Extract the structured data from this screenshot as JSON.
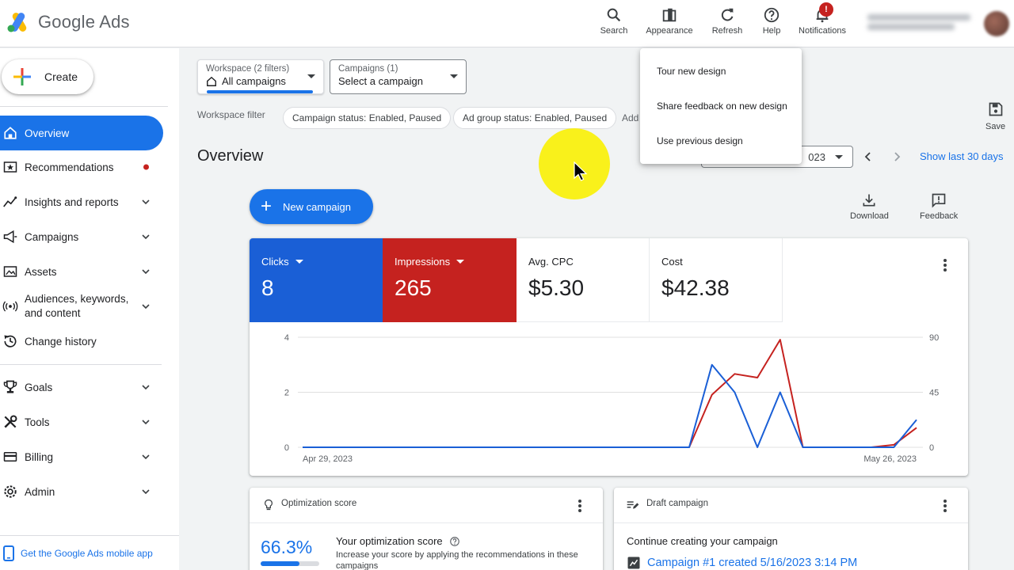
{
  "app": {
    "logo_text": "Google Ads"
  },
  "topbar": {
    "search": "Search",
    "appearance": "Appearance",
    "refresh": "Refresh",
    "help": "Help",
    "notifications": "Notifications",
    "notification_badge": "!"
  },
  "sidebar": {
    "create": "Create",
    "items": [
      {
        "label": "Overview"
      },
      {
        "label": "Recommendations"
      },
      {
        "label": "Insights and reports"
      },
      {
        "label": "Campaigns"
      },
      {
        "label": "Assets"
      },
      {
        "label": "Audiences, keywords,",
        "label2": "and content"
      },
      {
        "label": "Change history"
      },
      {
        "label": "Goals"
      },
      {
        "label": "Tools"
      },
      {
        "label": "Billing"
      },
      {
        "label": "Admin"
      }
    ],
    "mobile_app": "Get the Google Ads mobile app"
  },
  "filters": {
    "workspace_small": "Workspace (2 filters)",
    "workspace_value": "All campaigns",
    "campaigns_small": "Campaigns (1)",
    "campaigns_value": "Select a campaign",
    "workspace_filter_label": "Workspace filter",
    "chips": [
      "Campaign status: Enabled, Paused",
      "Ad group status: Enabled, Paused",
      "Add"
    ]
  },
  "page": {
    "title": "Overview",
    "save": "Save",
    "date_value": "023",
    "show_last": "Show last 30 days",
    "new_campaign": "New campaign",
    "download": "Download",
    "feedback": "Feedback"
  },
  "appearance_menu": {
    "items": [
      "Tour new design",
      "Share feedback on new design",
      "Use previous design"
    ]
  },
  "metrics": [
    {
      "label": "Clicks",
      "value": "8",
      "color": "#1a5fd6",
      "selected": true
    },
    {
      "label": "Impressions",
      "value": "265",
      "color": "#c5221f",
      "selected": true
    },
    {
      "label": "Avg. CPC",
      "value": "$5.30",
      "selected": false
    },
    {
      "label": "Cost",
      "value": "$42.38",
      "selected": false
    }
  ],
  "chart_data": {
    "type": "line",
    "x_start_label": "Apr 29, 2023",
    "x_end_label": "May 26, 2023",
    "left_axis_ticks": [
      "0",
      "2",
      "4"
    ],
    "right_axis_ticks": [
      "0",
      "45",
      "90"
    ],
    "ylim_left": [
      0,
      4
    ],
    "ylim_right": [
      0,
      90
    ],
    "x_count": 28,
    "series": [
      {
        "name": "Clicks",
        "axis": "left",
        "color": "#1a5fd6",
        "values": [
          0,
          0,
          0,
          0,
          0,
          0,
          0,
          0,
          0,
          0,
          0,
          0,
          0,
          0,
          0,
          0,
          0,
          0,
          3,
          2,
          0,
          2,
          0,
          0,
          0,
          0,
          0,
          1
        ]
      },
      {
        "name": "Impressions",
        "axis": "right",
        "color": "#c5221f",
        "values": [
          0,
          0,
          0,
          0,
          0,
          0,
          0,
          0,
          0,
          0,
          0,
          0,
          0,
          0,
          0,
          0,
          0,
          0,
          43,
          60,
          57,
          88,
          0,
          0,
          0,
          0,
          2,
          16
        ]
      }
    ]
  },
  "optimization_card": {
    "title": "Optimization score",
    "score": "66.3%",
    "score_fraction": 0.663,
    "heading": "Your optimization score",
    "description": "Increase your score by applying the recommendations in these campaigns"
  },
  "draft_card": {
    "title": "Draft campaign",
    "heading": "Continue creating your campaign",
    "link": "Campaign #1 created 5/16/2023 3:14 PM"
  }
}
